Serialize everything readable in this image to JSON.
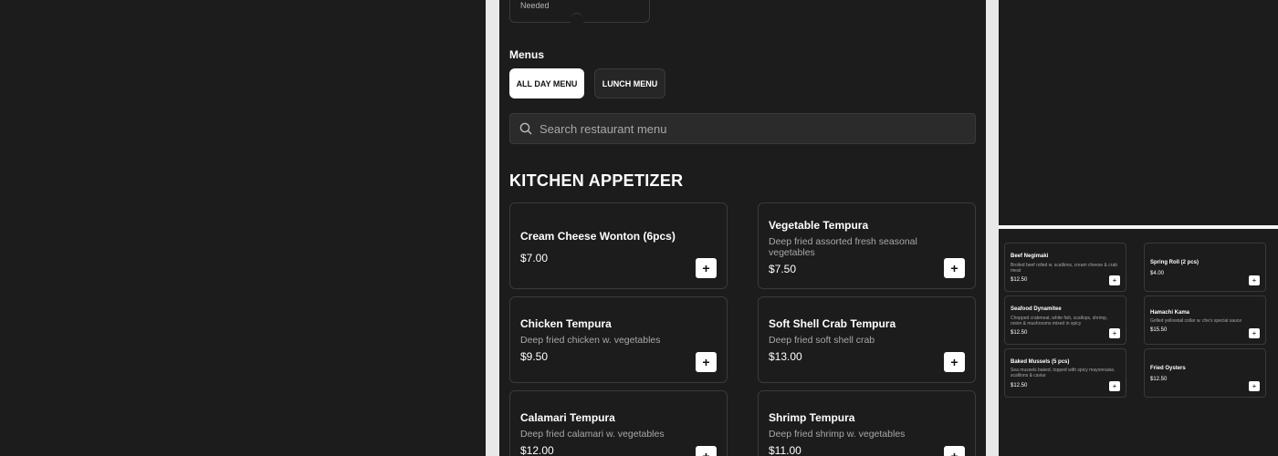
{
  "top_card": {
    "text": "Needed"
  },
  "menus": {
    "label": "Menus",
    "buttons": [
      {
        "label": "ALL DAY MENU",
        "active": true
      },
      {
        "label": "LUNCH MENU",
        "active": false
      }
    ]
  },
  "search": {
    "placeholder": "Search restaurant menu",
    "value": ""
  },
  "section": {
    "title": "KITCHEN APPETIZER"
  },
  "items": [
    {
      "name": "Cream Cheese Wonton (6pcs)",
      "desc": "",
      "price": "$7.00"
    },
    {
      "name": "Vegetable Tempura",
      "desc": "Deep fried assorted fresh seasonal vegetables",
      "price": "$7.50"
    },
    {
      "name": "Chicken Tempura",
      "desc": "Deep fried chicken w. vegetables",
      "price": "$9.50"
    },
    {
      "name": "Soft Shell Crab Tempura",
      "desc": "Deep fried soft shell crab",
      "price": "$13.00"
    },
    {
      "name": "Calamari Tempura",
      "desc": "Deep fried calamari w. vegetables",
      "price": "$12.00"
    },
    {
      "name": "Shrimp Tempura",
      "desc": "Deep fried shrimp w. vegetables",
      "price": "$11.00"
    }
  ],
  "add_label": "+",
  "preview_items": [
    {
      "name": "Beef Negimaki",
      "desc": "Broiled beef rolled w. scallions, cream cheese & crab meat",
      "price": "$12.50"
    },
    {
      "name": "Spring Roll (2 pcs)",
      "desc": "",
      "price": "$4.00"
    },
    {
      "name": "Seafood Dynamitee",
      "desc": "Chopped crabmeat, white fish, scallops, shrimp, onion & mushrooms mixed in spicy",
      "price": "$12.50"
    },
    {
      "name": "Hamachi Kama",
      "desc": "Grilled yellowtail collar w. che's special sauce",
      "price": "$15.50"
    },
    {
      "name": "Baked Mussels (5 pcs)",
      "desc": "Sea mussels baked, topped with spicy mayonnaise, scallions & caviar",
      "price": "$12.50"
    },
    {
      "name": "Fried Oysters",
      "desc": "",
      "price": "$12.50"
    }
  ],
  "colors": {
    "background": "#1c1c1c",
    "card_border": "#3a3a3a",
    "accent_button": "#ffffff",
    "muted_text": "#a8a8a8"
  },
  "icons": {
    "search": "search-icon",
    "add": "plus-icon"
  }
}
